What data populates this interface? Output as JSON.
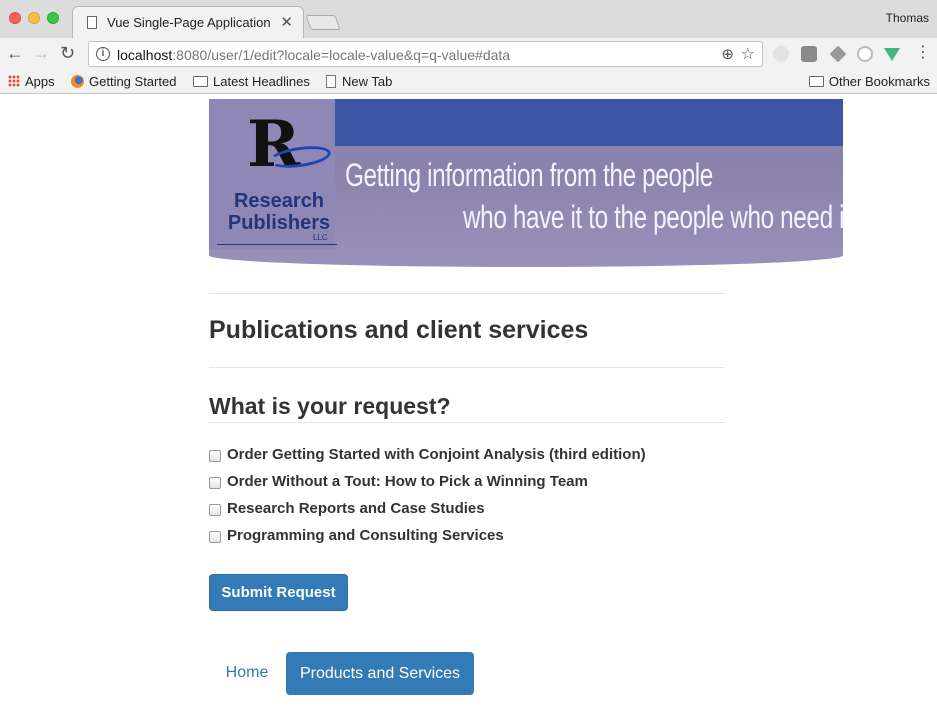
{
  "browser": {
    "tab_title": "Vue Single-Page Application",
    "tab_close": "✕",
    "profile_name": "Thomas",
    "url_host": "localhost",
    "url_rest": ":8080/user/1/edit?locale=locale-value&q=q-value#data",
    "bookmarks": {
      "apps": "Apps",
      "getting_started": "Getting Started",
      "latest_headlines": "Latest Headlines",
      "new_tab": "New Tab",
      "other_bookmarks": "Other Bookmarks"
    }
  },
  "banner": {
    "logo_letter": "R",
    "logo_name": "Research Publishers",
    "logo_suffix": "LLC",
    "tagline_1": "Getting information from the people",
    "tagline_2": "who have it to the people who need it",
    "colors": {
      "top_bar": "#3e55a6",
      "background": "#8a82ab"
    }
  },
  "main": {
    "page_title": "Publications and client services",
    "section_title": "What is your request?",
    "options": [
      {
        "label": "Order Getting Started with Conjoint Analysis (third edition)",
        "checked": false
      },
      {
        "label": "Order Without a Tout: How to Pick a Winning Team",
        "checked": false
      },
      {
        "label": "Research Reports and Case Studies",
        "checked": false
      },
      {
        "label": "Programming and Consulting Services",
        "checked": false
      }
    ],
    "submit_label": "Submit Request"
  },
  "nav": {
    "home": "Home",
    "products": "Products and Services",
    "active": "products",
    "accent_color": "#337ab7"
  }
}
